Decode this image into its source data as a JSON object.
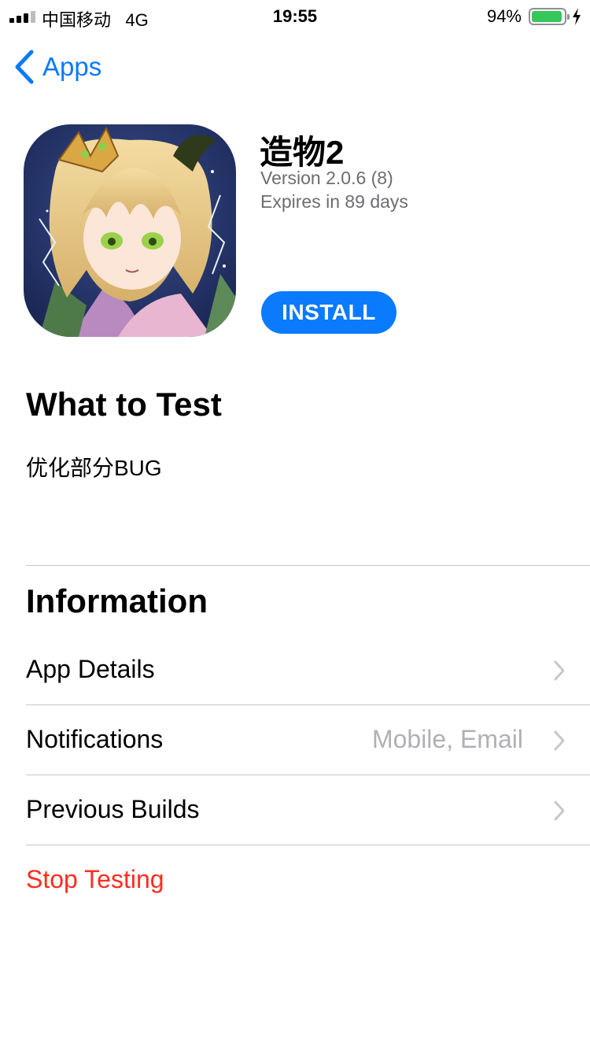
{
  "status_bar": {
    "carrier": "中国移动",
    "network": "4G",
    "time": "19:55",
    "battery_percent": "94%",
    "battery_level": 0.94,
    "battery_color": "#34c759"
  },
  "nav": {
    "back_icon": "chevron-left-icon",
    "back_label": "Apps"
  },
  "app": {
    "name": "造物2",
    "version": "Version 2.0.6 (8)",
    "expires": "Expires in 89 days",
    "install_label": "INSTALL"
  },
  "what_to_test": {
    "heading": "What to Test",
    "notes": "优化部分BUG"
  },
  "information": {
    "heading": "Information",
    "rows": [
      {
        "label": "App Details",
        "value": "",
        "icon": "chevron-right-icon"
      },
      {
        "label": "Notifications",
        "value": "Mobile, Email",
        "icon": "chevron-right-icon"
      },
      {
        "label": "Previous Builds",
        "value": "",
        "icon": "chevron-right-icon"
      }
    ],
    "stop_label": "Stop Testing"
  },
  "colors": {
    "accent": "#0a7aff",
    "destructive": "#ff2d20",
    "secondary_text": "#6d6d72"
  }
}
